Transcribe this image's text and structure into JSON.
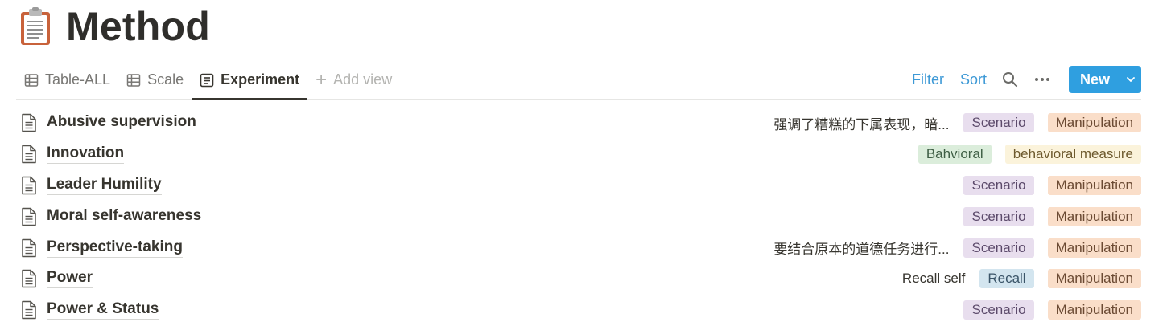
{
  "page": {
    "title": "Method",
    "icon": "clipboard-icon"
  },
  "views": {
    "tabs": [
      {
        "label": "Table-ALL",
        "icon": "table-icon"
      },
      {
        "label": "Scale",
        "icon": "table-icon"
      },
      {
        "label": "Experiment",
        "icon": "list-view-icon",
        "active": true
      }
    ],
    "add_view_label": "Add view"
  },
  "actions": {
    "filter_label": "Filter",
    "sort_label": "Sort",
    "new_label": "New"
  },
  "colors": {
    "accent_blue": "#2f9fe0",
    "link_blue": "#3d99d6",
    "tag_purple": "#e8deee",
    "tag_orange": "#fadec9",
    "tag_green": "#dbeddb",
    "tag_yellow": "#fbf3db",
    "tag_blue": "#d3e5ef"
  },
  "rows": [
    {
      "name": "Abusive supervision",
      "note": "强调了糟糕的下属表现，暗...",
      "tags": [
        {
          "label": "Scenario",
          "color": "purple"
        },
        {
          "label": "Manipulation",
          "color": "orange"
        }
      ]
    },
    {
      "name": "Innovation",
      "note": "",
      "tags": [
        {
          "label": "Bahvioral",
          "color": "green"
        },
        {
          "label": "behavioral measure",
          "color": "yellow"
        }
      ]
    },
    {
      "name": "Leader Humility",
      "note": "",
      "tags": [
        {
          "label": "Scenario",
          "color": "purple"
        },
        {
          "label": "Manipulation",
          "color": "orange"
        }
      ]
    },
    {
      "name": "Moral self-awareness",
      "note": "",
      "tags": [
        {
          "label": "Scenario",
          "color": "purple"
        },
        {
          "label": "Manipulation",
          "color": "orange"
        }
      ]
    },
    {
      "name": "Perspective-taking",
      "note": "要结合原本的道德任务进行...",
      "tags": [
        {
          "label": "Scenario",
          "color": "purple"
        },
        {
          "label": "Manipulation",
          "color": "orange"
        }
      ]
    },
    {
      "name": "Power",
      "note": "Recall self",
      "tags": [
        {
          "label": "Recall",
          "color": "blue"
        },
        {
          "label": "Manipulation",
          "color": "orange"
        }
      ]
    },
    {
      "name": "Power & Status",
      "note": "",
      "tags": [
        {
          "label": "Scenario",
          "color": "purple"
        },
        {
          "label": "Manipulation",
          "color": "orange"
        }
      ]
    }
  ]
}
